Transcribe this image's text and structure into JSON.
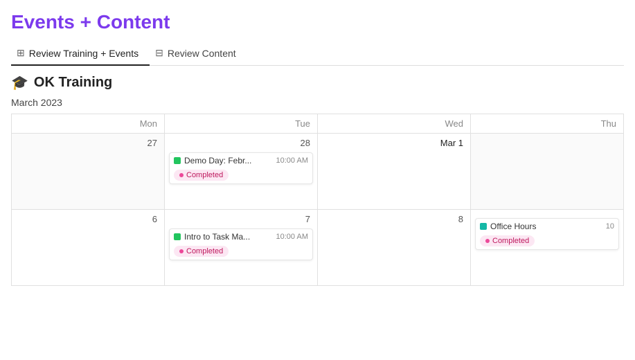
{
  "header": {
    "title": "Events + Content"
  },
  "tabs": [
    {
      "id": "tab-review-training",
      "label": "Review Training + Events",
      "icon": "📅",
      "active": true
    },
    {
      "id": "tab-review-content",
      "label": "Review Content",
      "icon": "📋",
      "active": false
    }
  ],
  "section": {
    "icon": "🎓",
    "title": "OK Training",
    "month": "March 2023"
  },
  "calendar": {
    "headers": [
      "Mon",
      "Tue",
      "Wed",
      "Thu"
    ],
    "rows": [
      {
        "cells": [
          {
            "day": "27",
            "event": null,
            "empty": true
          },
          {
            "day": "28",
            "event": {
              "name": "Demo Day: Febr...",
              "time": "10:00 AM",
              "dotColor": "green",
              "status": "Completed"
            }
          },
          {
            "day": "Mar 1",
            "highlight": true,
            "event": null
          },
          {
            "day": "",
            "event": null,
            "empty": true
          }
        ]
      },
      {
        "cells": [
          {
            "day": "6",
            "event": null
          },
          {
            "day": "7",
            "event": {
              "name": "Intro to Task Ma...",
              "time": "10:00 AM",
              "dotColor": "green",
              "status": "Completed"
            }
          },
          {
            "day": "8",
            "event": null
          },
          {
            "day": "",
            "event": {
              "name": "Office Hours",
              "time": "10",
              "dotColor": "teal",
              "status": "Completed"
            }
          }
        ]
      }
    ],
    "completed_label": "Completed"
  }
}
